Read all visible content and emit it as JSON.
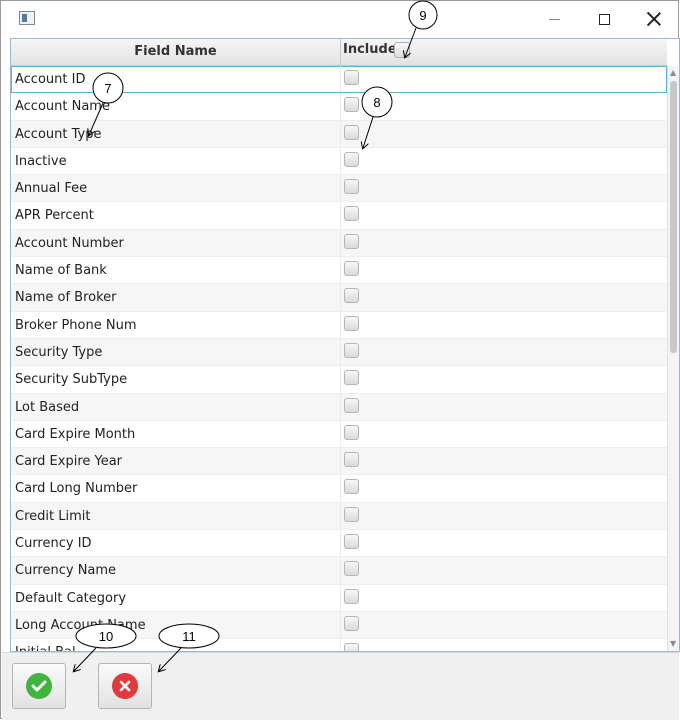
{
  "window": {
    "title": "",
    "icons": {
      "app": "app-icon",
      "minimize": "minimize-icon",
      "maximize": "maximize-icon",
      "close": "close-icon"
    }
  },
  "table": {
    "columns": {
      "field_name": "Field Name",
      "include": "Include"
    },
    "rows": [
      {
        "label": "Account ID",
        "checked": false,
        "selected": true
      },
      {
        "label": "Account Name",
        "checked": false
      },
      {
        "label": "Account Type",
        "checked": false
      },
      {
        "label": "Inactive",
        "checked": false
      },
      {
        "label": "Annual Fee",
        "checked": false
      },
      {
        "label": "APR Percent",
        "checked": false
      },
      {
        "label": "Account Number",
        "checked": false
      },
      {
        "label": "Name of Bank",
        "checked": false
      },
      {
        "label": "Name of Broker",
        "checked": false
      },
      {
        "label": "Broker Phone Num",
        "checked": false
      },
      {
        "label": "Security Type",
        "checked": false
      },
      {
        "label": "Security SubType",
        "checked": false
      },
      {
        "label": "Lot Based",
        "checked": false
      },
      {
        "label": "Card Expire Month",
        "checked": false
      },
      {
        "label": "Card Expire Year",
        "checked": false
      },
      {
        "label": "Card Long Number",
        "checked": false
      },
      {
        "label": "Credit Limit",
        "checked": false
      },
      {
        "label": "Currency ID",
        "checked": false
      },
      {
        "label": "Currency Name",
        "checked": false
      },
      {
        "label": "Default Category",
        "checked": false
      },
      {
        "label": "Long Account Name",
        "checked": false
      },
      {
        "label": "Initial Bal...",
        "checked": false
      }
    ]
  },
  "footer": {
    "ok_icon": "checkmark-icon",
    "cancel_icon": "x-icon"
  },
  "callouts": [
    "7",
    "8",
    "9",
    "10",
    "11"
  ],
  "colors": {
    "ok": "#3fb53f",
    "cancel": "#e03a3a",
    "selection": "#5eb0d6"
  }
}
